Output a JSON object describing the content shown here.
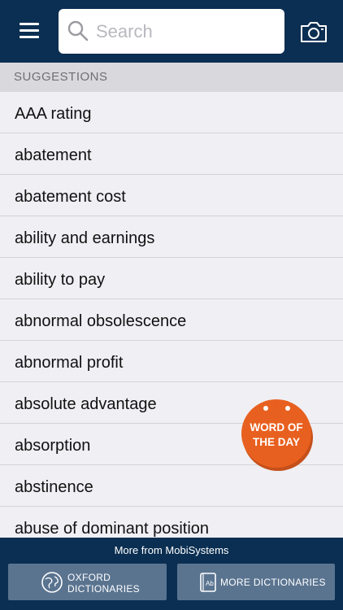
{
  "header": {
    "search_placeholder": "Search",
    "menu_icon": "hamburger-menu-icon",
    "camera_icon": "camera-icon",
    "search_icon": "search-icon"
  },
  "suggestions": {
    "title": "SUGGESTIONS",
    "items": [
      "AAA rating",
      "abatement",
      "abatement cost",
      "ability and earnings",
      "ability to pay",
      "abnormal obsolescence",
      "abnormal profit",
      "absolute advantage",
      "absorption",
      "abstinence",
      "abuse of dominant position"
    ]
  },
  "word_of_the_day": {
    "line1": "WORD OF",
    "line2": "THE DAY",
    "color": "#e8601f"
  },
  "footer": {
    "more_from": "More from MobiSystems",
    "oxford_line1": "OXFORD",
    "oxford_line2": "DICTIONARIES",
    "more_dictionaries": "MORE DICTIONARIES",
    "oxford_icon": "globe-icon",
    "more_icon": "dictionary-book-icon"
  },
  "colors": {
    "navy": "#0b2f52",
    "button": "#5a7490",
    "background": "#efeff4"
  }
}
